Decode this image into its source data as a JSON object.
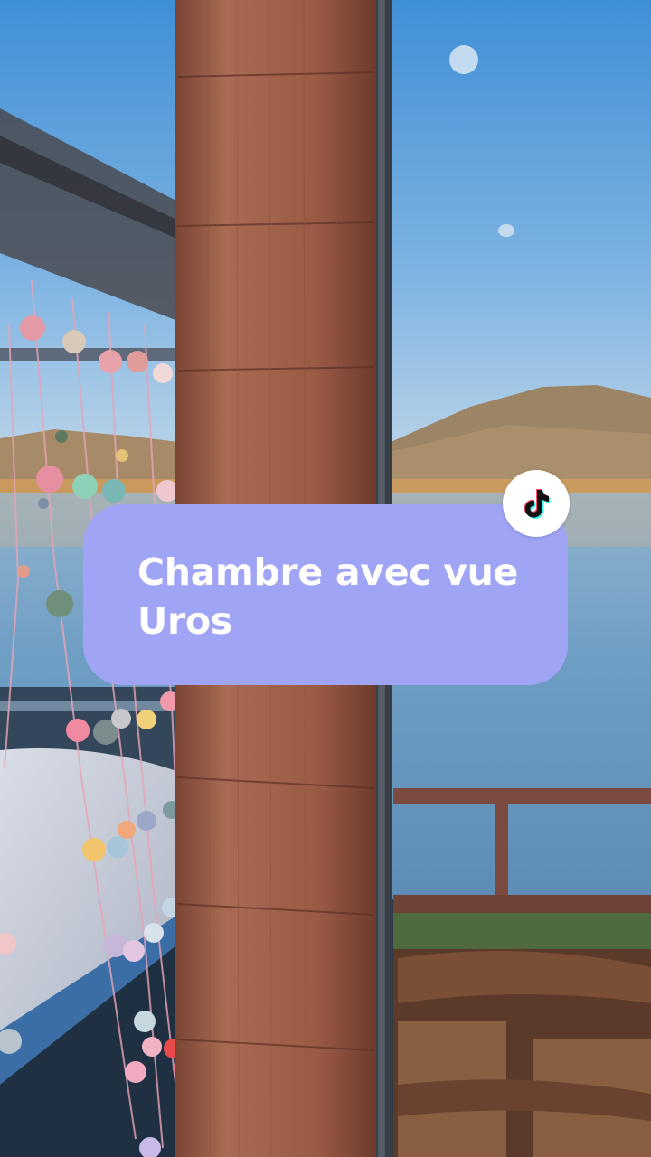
{
  "caption": {
    "line1": "Chambre avec vue",
    "line2": "Uros"
  },
  "badge": {
    "icon": "tiktok-logo-icon",
    "background": "#ffffff"
  },
  "colors": {
    "caption_bg": "#a0a4f5",
    "caption_text": "#ffffff",
    "sky_top": "#3f8fd6",
    "sky_bottom": "#b9d6ea",
    "pillar": "#9b5a46"
  }
}
